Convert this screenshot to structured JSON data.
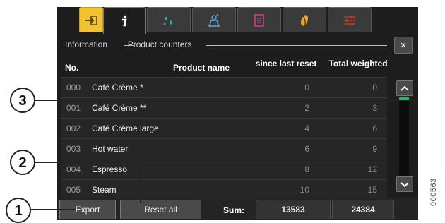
{
  "tabs": [
    {
      "name": "exit",
      "icon": "exit-arrow-icon"
    },
    {
      "name": "information",
      "icon": "info-icon"
    },
    {
      "name": "care",
      "icon": "water-drops-icon"
    },
    {
      "name": "service",
      "icon": "technician-icon"
    },
    {
      "name": "recipes",
      "icon": "list-icon"
    },
    {
      "name": "products",
      "icon": "coffee-bean-icon"
    },
    {
      "name": "settings",
      "icon": "sliders-icon"
    }
  ],
  "breadcrumb": {
    "level1": "Information",
    "level2": "Product counters"
  },
  "close_label": "×",
  "table": {
    "headers": {
      "no": "No.",
      "name": "Product name",
      "since": "since last reset",
      "total": "Total weighted"
    },
    "rows": [
      {
        "no": "000",
        "name": "Café Crème *",
        "since": "0",
        "total": "0"
      },
      {
        "no": "001",
        "name": "Café Crème **",
        "since": "2",
        "total": "3"
      },
      {
        "no": "002",
        "name": "Café Crème large",
        "since": "4",
        "total": "6"
      },
      {
        "no": "003",
        "name": "Hot water",
        "since": "6",
        "total": "9"
      },
      {
        "no": "004",
        "name": "Espresso",
        "since": "8",
        "total": "12"
      },
      {
        "no": "005",
        "name": "Steam",
        "since": "10",
        "total": "15"
      }
    ]
  },
  "footer": {
    "export_label": "Export",
    "reset_label": "Reset all",
    "sum_label": "Sum:",
    "sum_since": "13583",
    "sum_total": "24384"
  },
  "callouts": [
    "1",
    "2",
    "3"
  ],
  "figure_id": "000563",
  "colors": {
    "accent": "#f1c232",
    "scroll_thumb": "#29b473",
    "background": "#1d1d1d"
  }
}
